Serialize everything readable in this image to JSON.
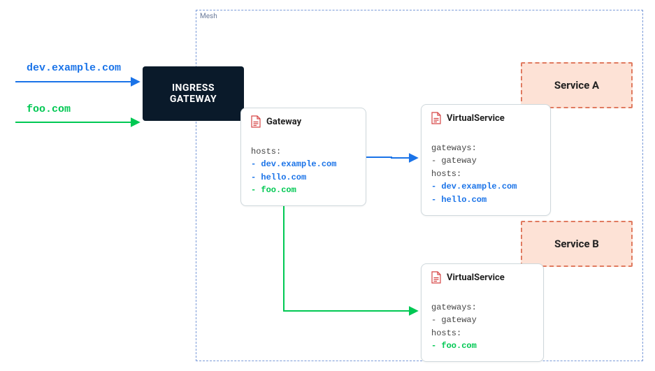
{
  "mesh_label": "Mesh",
  "ingress_label": "INGRESS\nGATEWAY",
  "external": {
    "host_blue": "dev.example.com",
    "host_green": "foo.com"
  },
  "gateway_card": {
    "title": "Gateway",
    "key_hosts": "hosts:",
    "hosts": {
      "h1": "- dev.example.com",
      "h2": "- hello.com",
      "h3": "- foo.com"
    }
  },
  "vs_a": {
    "title": "VirtualService",
    "key_gateways": "gateways:",
    "gw_item": "- gateway",
    "key_hosts": "hosts:",
    "hosts": {
      "h1": "- dev.example.com",
      "h2": "- hello.com"
    }
  },
  "vs_b": {
    "title": "VirtualService",
    "key_gateways": "gateways:",
    "gw_item": "- gateway",
    "key_hosts": "hosts:",
    "hosts": {
      "h1": "- foo.com"
    }
  },
  "service_a_label": "Service A",
  "service_b_label": "Service B",
  "colors": {
    "blue": "#1a73e8",
    "green": "#00c853",
    "orange_border": "#e07a5f",
    "orange_fill": "#fde2d6",
    "mesh_border": "#7a9ad8",
    "ink": "#0a1a2a"
  }
}
